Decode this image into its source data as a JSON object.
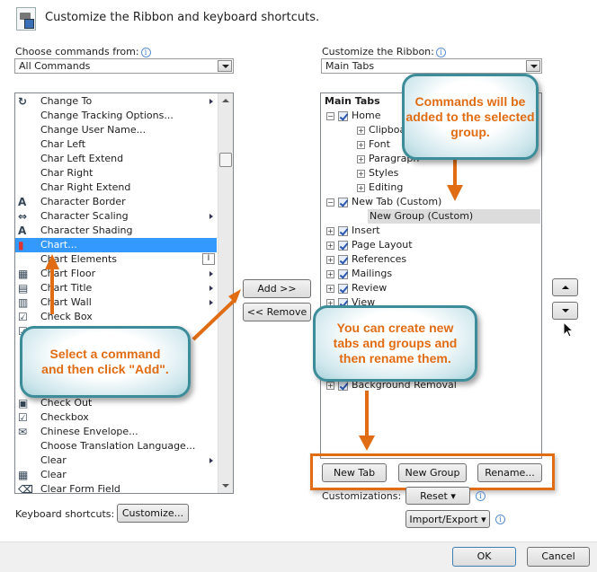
{
  "header": {
    "title": "Customize the Ribbon and keyboard shortcuts.",
    "icon": "customize-ribbon-icon"
  },
  "left": {
    "label": "Choose commands from:",
    "select_value": "All Commands",
    "commands": [
      {
        "label": "Change To",
        "icon": "change-to-icon",
        "submenu": true
      },
      {
        "label": "Change Tracking Options...",
        "icon": "",
        "submenu": false
      },
      {
        "label": "Change User Name...",
        "icon": "",
        "submenu": false
      },
      {
        "label": "Char Left",
        "icon": "",
        "submenu": false
      },
      {
        "label": "Char Left Extend",
        "icon": "",
        "submenu": false
      },
      {
        "label": "Char Right",
        "icon": "",
        "submenu": false
      },
      {
        "label": "Char Right Extend",
        "icon": "",
        "submenu": false
      },
      {
        "label": "Character Border",
        "icon": "character-border-icon",
        "submenu": false
      },
      {
        "label": "Character Scaling",
        "icon": "character-scaling-icon",
        "submenu": true
      },
      {
        "label": "Character Shading",
        "icon": "character-shading-icon",
        "submenu": false
      },
      {
        "label": "Chart...",
        "icon": "chart-icon",
        "submenu": false,
        "selected": true
      },
      {
        "label": "Chart Elements",
        "icon": "",
        "submenu": false,
        "textbox": true
      },
      {
        "label": "Chart Floor",
        "icon": "chart-floor-icon",
        "submenu": true
      },
      {
        "label": "Chart Title",
        "icon": "chart-title-icon",
        "submenu": true
      },
      {
        "label": "Chart Wall",
        "icon": "chart-wall-icon",
        "submenu": true
      },
      {
        "label": "Check Box",
        "icon": "checkbox-icon",
        "submenu": false
      },
      {
        "label": "",
        "icon": "checkbox-icon",
        "submenu": false
      },
      {
        "label": "",
        "icon": "",
        "submenu": false
      },
      {
        "label": "",
        "icon": "",
        "submenu": false
      },
      {
        "label": "",
        "icon": "",
        "submenu": false
      },
      {
        "label": "",
        "icon": "",
        "submenu": false
      },
      {
        "label": "Check Out",
        "icon": "check-out-icon",
        "submenu": false
      },
      {
        "label": "Checkbox",
        "icon": "checkbox-icon",
        "submenu": false
      },
      {
        "label": "Chinese Envelope...",
        "icon": "envelope-icon",
        "submenu": false
      },
      {
        "label": "Choose Translation Language...",
        "icon": "",
        "submenu": false
      },
      {
        "label": "Clear",
        "icon": "",
        "submenu": true
      },
      {
        "label": "Clear",
        "icon": "clear-table-icon",
        "submenu": false
      },
      {
        "label": "Clear Form Field",
        "icon": "eraser-icon",
        "submenu": false
      }
    ],
    "keyboard_label": "Keyboard shortcuts:",
    "customize_button": "Customize..."
  },
  "middle": {
    "add_button": "Add >>",
    "remove_button": "<< Remove"
  },
  "right": {
    "label": "Customize the Ribbon:",
    "select_value": "Main Tabs",
    "tree_header": "Main Tabs",
    "tree": [
      {
        "label": "Home",
        "level": 0,
        "expand": "-",
        "checkbox": true
      },
      {
        "label": "Clipboard",
        "level": 1,
        "expand": "+",
        "checkbox": false
      },
      {
        "label": "Font",
        "level": 1,
        "expand": "+",
        "checkbox": false
      },
      {
        "label": "Paragraph",
        "level": 1,
        "expand": "+",
        "checkbox": false
      },
      {
        "label": "Styles",
        "level": 1,
        "expand": "+",
        "checkbox": false
      },
      {
        "label": "Editing",
        "level": 1,
        "expand": "+",
        "checkbox": false
      },
      {
        "label": "New Tab (Custom)",
        "level": 0,
        "expand": "-",
        "checkbox": true
      },
      {
        "label": "New Group (Custom)",
        "level": 2,
        "expand": "",
        "checkbox": false,
        "selected": true
      },
      {
        "label": "Insert",
        "level": 0,
        "expand": "+",
        "checkbox": true
      },
      {
        "label": "Page Layout",
        "level": 0,
        "expand": "+",
        "checkbox": true
      },
      {
        "label": "References",
        "level": 0,
        "expand": "+",
        "checkbox": true
      },
      {
        "label": "Mailings",
        "level": 0,
        "expand": "+",
        "checkbox": true
      },
      {
        "label": "Review",
        "level": 0,
        "expand": "+",
        "checkbox": true
      },
      {
        "label": "View",
        "level": 0,
        "expand": "+",
        "checkbox": true
      },
      {
        "label": "Background Removal",
        "level": 0,
        "expand": "+",
        "checkbox": true
      }
    ],
    "new_tab_button": "New Tab",
    "new_group_button": "New Group",
    "rename_button": "Rename...",
    "customizations_label": "Customizations:",
    "reset_button": "Reset",
    "import_export_button": "Import/Export"
  },
  "callouts": {
    "commands_added": "Commands will be added to the selected group.",
    "select_command": "Select a command and then click \"Add\".",
    "create_new": "You can create new tabs and groups and then rename them."
  },
  "footer": {
    "ok_button": "OK",
    "cancel_button": "Cancel"
  },
  "colors": {
    "accent_orange": "#e06c14",
    "callout_border": "#3d8c99",
    "selection_blue": "#3399ff"
  }
}
